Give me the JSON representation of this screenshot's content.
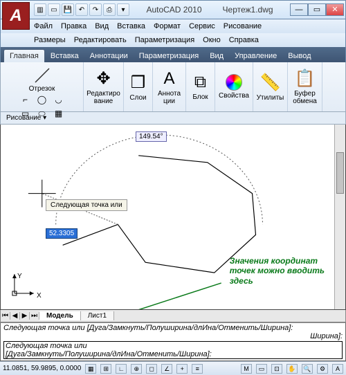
{
  "window": {
    "app": "AutoCAD 2010",
    "doc": "Чертеж1.dwg",
    "min": "—",
    "max": "▭",
    "close": "✕"
  },
  "qat": {
    "new": "▥",
    "open": "▭",
    "save": "💾",
    "undo": "↶",
    "redo": "↷",
    "print": "⎙",
    "dd": "▾"
  },
  "menu1": {
    "file": "Файл",
    "edit": "Правка",
    "view": "Вид",
    "insert": "Вставка",
    "format": "Формат",
    "service": "Сервис",
    "draw": "Рисование"
  },
  "menu2": {
    "dims": "Размеры",
    "modify": "Редактировать",
    "param": "Параметризация",
    "window": "Окно",
    "help": "Справка"
  },
  "tabs": {
    "home": "Главная",
    "insert": "Вставка",
    "annot": "Аннотации",
    "param": "Параметризация",
    "view": "Вид",
    "manage": "Управление",
    "output": "Вывод"
  },
  "ribbon": {
    "segment": "Отрезок",
    "edit": "Редактиро\nвание",
    "layers": "Слои",
    "annot": "Аннота\nции",
    "block": "Блок",
    "props": "Свойства",
    "utils": "Утилиты",
    "clip": "Буфер\nобмена",
    "drawing": "Рисование ▾"
  },
  "canvas": {
    "angle": "149.54°",
    "tooltip": "Следующая точка или",
    "dist": "52.3305",
    "annot_l1": "Значения координат",
    "annot_l2": "точек можно вводить",
    "annot_l3": "здесь",
    "ucsY": "Y",
    "ucsX": "X"
  },
  "sheets": {
    "model": "Модель",
    "sheet1": "Лист1"
  },
  "cmd": {
    "l1": "Следующая точка или [Дуга/Замкнуть/Полуширина/длИна/Отменить/Ширина]:",
    "l2": "Следующая точка или",
    "l3": "[Дуга/Замкнуть/Полуширина/длИна/Отменить/Ширина]:",
    "tail": "Ширина]:"
  },
  "status": {
    "coords": "11.0851, 59.9895, 0.0000"
  }
}
